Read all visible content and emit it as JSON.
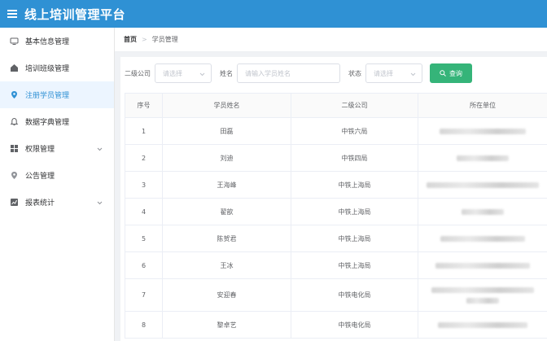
{
  "header": {
    "title": "线上培训管理平台",
    "menu_icon": "hamburger-icon"
  },
  "sidebar": {
    "items": [
      {
        "label": "基本信息管理",
        "icon": "monitor-icon",
        "active": false,
        "has_children": false
      },
      {
        "label": "培训班级管理",
        "icon": "classroom-icon",
        "active": false,
        "has_children": false
      },
      {
        "label": "注册学员管理",
        "icon": "location-pin-icon",
        "active": true,
        "has_children": false
      },
      {
        "label": "数据字典管理",
        "icon": "bell-icon",
        "active": false,
        "has_children": false
      },
      {
        "label": "权限管理",
        "icon": "grid-icon",
        "active": false,
        "has_children": true
      },
      {
        "label": "公告管理",
        "icon": "megaphone-icon",
        "active": false,
        "has_children": false
      },
      {
        "label": "报表统计",
        "icon": "chart-icon",
        "active": false,
        "has_children": true
      }
    ]
  },
  "breadcrumb": {
    "home": "首页",
    "separator": ">",
    "current": "学员管理"
  },
  "filters": {
    "company_label": "二级公司",
    "company_placeholder": "请选择",
    "name_label": "姓名",
    "name_placeholder": "请输入学员姓名",
    "status_label": "状态",
    "status_placeholder": "请选择",
    "query_button": "查询"
  },
  "table": {
    "columns": [
      "序号",
      "学员姓名",
      "二级公司",
      "所在单位"
    ],
    "rows": [
      {
        "index": "1",
        "name": "田磊",
        "company": "中铁六局",
        "unit_redacted": true
      },
      {
        "index": "2",
        "name": "刘迪",
        "company": "中铁四局",
        "unit_redacted": true
      },
      {
        "index": "3",
        "name": "王海峰",
        "company": "中铁上海局",
        "unit_redacted": true
      },
      {
        "index": "4",
        "name": "翟歆",
        "company": "中铁上海局",
        "unit_redacted": true
      },
      {
        "index": "5",
        "name": "陈贺君",
        "company": "中铁上海局",
        "unit_redacted": true
      },
      {
        "index": "6",
        "name": "王冰",
        "company": "中铁上海局",
        "unit_redacted": true
      },
      {
        "index": "7",
        "name": "安迎春",
        "company": "中铁电化局",
        "unit_redacted": true
      },
      {
        "index": "8",
        "name": "黎卓艺",
        "company": "中铁电化局",
        "unit_redacted": true
      }
    ]
  },
  "colors": {
    "header_bg": "#2f91d4",
    "active_nav_bg": "#ecf5ff",
    "accent": "#2f91d4",
    "query_button": "#35b479"
  }
}
